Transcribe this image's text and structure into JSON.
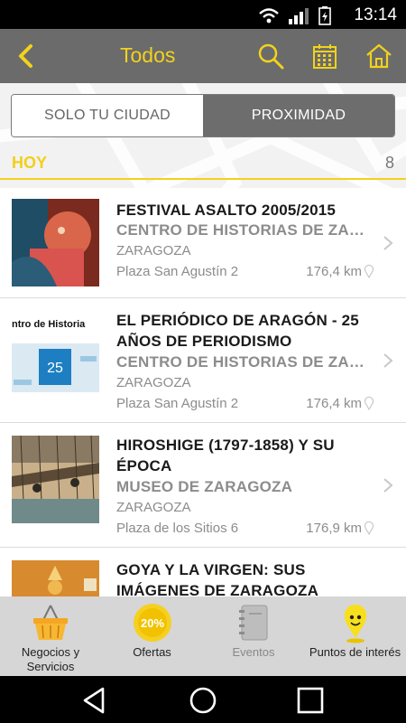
{
  "status": {
    "time": "13:14"
  },
  "appbar": {
    "title": "Todos"
  },
  "segment": {
    "left_label": "SOLO TU CIUDAD",
    "right_label": "PROXIMIDAD",
    "selected": "PROXIMIDAD"
  },
  "section": {
    "label": "HOY",
    "count": "8"
  },
  "items": [
    {
      "title": "FESTIVAL ASALTO 2005/2015",
      "venue": "CENTRO DE HISTORIAS DE ZARAGOZA",
      "city": "ZARAGOZA",
      "address": "Plaza San Agustín 2",
      "distance": "176,4 km"
    },
    {
      "title": "EL PERIÓDICO DE ARAGÓN - 25 AÑOS DE PERIODISMO",
      "venue": "CENTRO DE HISTORIAS DE ZARAGOZA",
      "city": "ZARAGOZA",
      "address": "Plaza San Agustín 2",
      "distance": "176,4 km",
      "thumb_text": "ntro de Historia",
      "thumb_badge": "25"
    },
    {
      "title": "HIROSHIGE (1797-1858) Y SU ÉPOCA",
      "venue": "MUSEO DE ZARAGOZA",
      "city": "ZARAGOZA",
      "address": "Plaza de los Sitios 6",
      "distance": "176,9 km"
    },
    {
      "title": "GOYA Y LA VIRGEN: SUS IMÁGENES DE ZARAGOZA",
      "venue": "",
      "city": "",
      "address": "",
      "distance": ""
    }
  ],
  "tabs": [
    {
      "label": "Negocios y Servicios",
      "icon": "basket-icon"
    },
    {
      "label": "Ofertas",
      "icon": "offer-badge-icon",
      "badge": "20%"
    },
    {
      "label": "Eventos",
      "icon": "notebook-icon"
    },
    {
      "label": "Puntos de interés",
      "icon": "pin-character-icon"
    }
  ],
  "colors": {
    "accent": "#f2d21c",
    "appbar": "#6b6b6b",
    "segment_selected": "#6d6d6d",
    "tabbar": "#d6d6d6"
  }
}
